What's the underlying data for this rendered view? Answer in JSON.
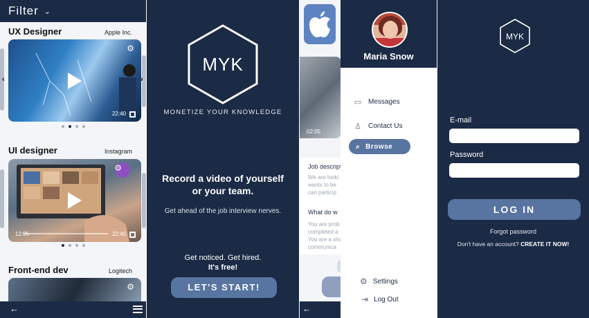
{
  "colors": {
    "navy": "#1b2a45",
    "accent": "#5874a0",
    "light_bg": "#f3f5f8"
  },
  "job_list": {
    "header_title": "Filter",
    "jobs": [
      {
        "title": "UX Designer",
        "company": "Apple Inc.",
        "duration": "22:40"
      },
      {
        "title": "UI designer",
        "company": "Instagram",
        "current_time": "12:05",
        "duration": "22:40"
      },
      {
        "title": "Front-end dev",
        "company": "Logitech"
      }
    ]
  },
  "splash": {
    "logo": "MYK",
    "tagline": "MONETIZE YOUR KNOWLEDGE",
    "headline_1": "Record a video of yourself",
    "headline_2": "or your team.",
    "subtext": "Get ahead of the job interview nerves.",
    "notice": "Get noticed. Get hired.",
    "notice_bold": "It's free!",
    "cta": "LET'S START!"
  },
  "detail": {
    "video_time": "02:05",
    "section_1": "Job descript",
    "section_1_lines": [
      "We are looki",
      "wants to be",
      "can particip"
    ],
    "section_2": "What do w",
    "section_2_lines": [
      "You are prob",
      "completed a",
      "You are a sha",
      "communica"
    ]
  },
  "drawer": {
    "user_name": "Maria Snow",
    "items": [
      "Messages",
      "Contact Us",
      "Browse"
    ],
    "settings": "Settings",
    "logout": "Log Out"
  },
  "login": {
    "logo": "MYK",
    "email_label": "E-mail",
    "password_label": "Password",
    "login_button": "LOG IN",
    "forgot": "Forgot password",
    "no_account": "Don't have an account?",
    "create": "CREATE IT NOW!"
  }
}
